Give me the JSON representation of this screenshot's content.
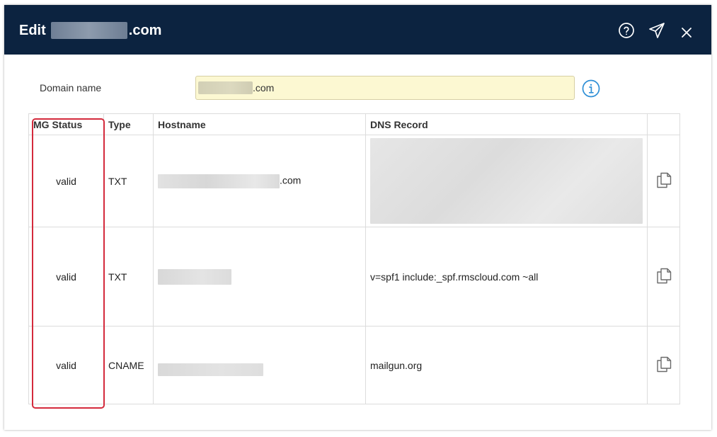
{
  "dialog": {
    "title_prefix": "Edit",
    "title_suffix": ".com",
    "icons": {
      "help": "question-circle-icon",
      "send": "paper-plane-icon",
      "close": "close-icon"
    },
    "colors": {
      "header_bg": "#0c2340",
      "input_bg": "#fcf8d2",
      "highlight": "#d42a3c",
      "info_icon": "#2e8fd6"
    }
  },
  "domain": {
    "label": "Domain name",
    "value_suffix": ".com",
    "info_icon": "info-circle-icon"
  },
  "table": {
    "columns": {
      "status": "MG Status",
      "type": "Type",
      "hostname": "Hostname",
      "record": "DNS Record"
    },
    "rows": [
      {
        "status": "valid",
        "type": "TXT",
        "hostname_suffix": ".com",
        "record": ""
      },
      {
        "status": "valid",
        "type": "TXT",
        "hostname_suffix": "",
        "record": "v=spf1 include:_spf.rmscloud.com ~all"
      },
      {
        "status": "valid",
        "type": "CNAME",
        "hostname_suffix": "",
        "record": "mailgun.org"
      }
    ],
    "copy_icon": "copy-icon"
  }
}
